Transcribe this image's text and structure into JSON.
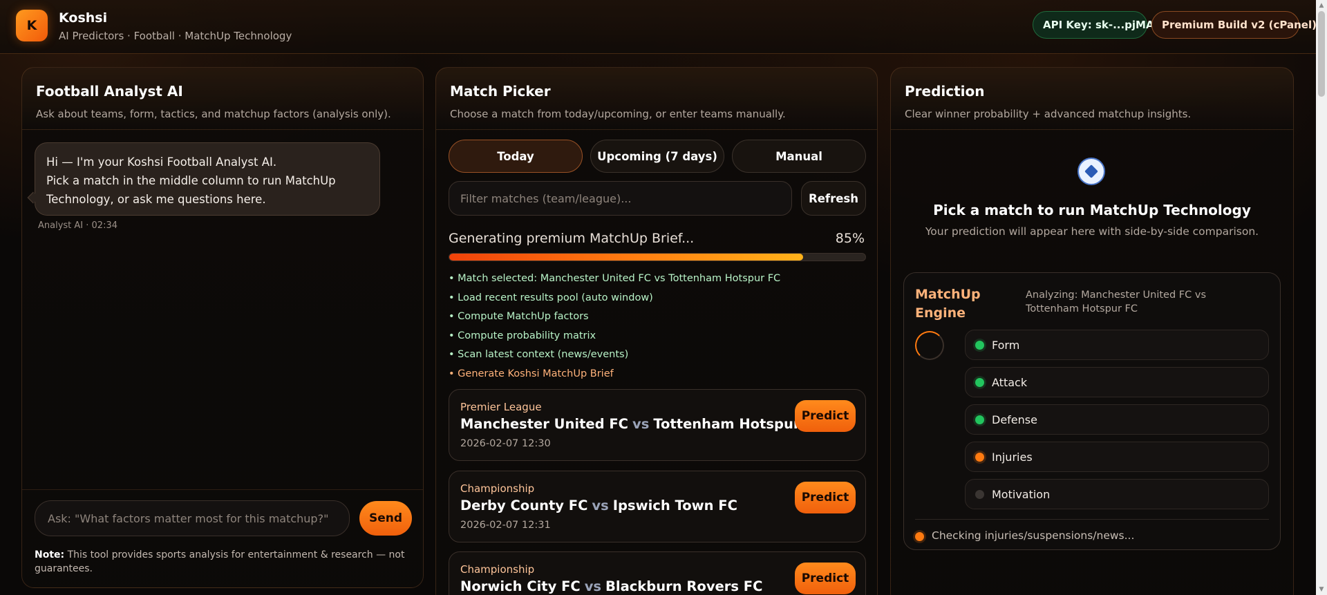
{
  "header": {
    "logo_letter": "K",
    "brand": "Koshsi",
    "subtitle": "AI Predictors · Football · MatchUp Technology",
    "api_key_label": "API Key: sk-...pjMA",
    "build_label": "Premium Build v2 (cPanel)"
  },
  "chat": {
    "title": "Football Analyst AI",
    "subtitle": "Ask about teams, form, tactics, and matchup factors (analysis only).",
    "messages": [
      {
        "line1": "Hi — I'm your Koshsi Football Analyst AI.",
        "line2": "Pick a match in the middle column to run MatchUp",
        "line3": "Technology, or ask me questions here.",
        "meta": "Analyst AI · 02:34"
      }
    ],
    "input_placeholder": "Ask: \"What factors matter most for this matchup?\"",
    "send_label": "Send",
    "note_bold": "Note:",
    "note_text": " This tool provides sports analysis for entertainment & research — not guarantees."
  },
  "picker": {
    "title": "Match Picker",
    "subtitle": "Choose a match from today/upcoming, or enter teams manually.",
    "tabs": [
      {
        "label": "Today",
        "active": true
      },
      {
        "label": "Upcoming (7 days)",
        "active": false
      },
      {
        "label": "Manual",
        "active": false
      }
    ],
    "filter_placeholder": "Filter matches (team/league)...",
    "refresh_label": "Refresh",
    "progress": {
      "label": "Generating premium MatchUp Brief...",
      "percent_text": "85%",
      "value": 0.85
    },
    "steps": [
      {
        "text": "• Match selected: Manchester United FC vs Tottenham Hotspur FC",
        "done": true
      },
      {
        "text": "• Load recent results pool (auto window)",
        "done": true
      },
      {
        "text": "• Compute MatchUp factors",
        "done": true
      },
      {
        "text": "• Compute probability matrix",
        "done": true
      },
      {
        "text": "• Scan latest context (news/events)",
        "done": true
      },
      {
        "text": "• Generate Koshsi MatchUp Brief",
        "done": false
      }
    ],
    "vs_label": "vs",
    "predict_label": "Predict",
    "matches": [
      {
        "league": "Premier League",
        "home": "Manchester United FC",
        "away": "Tottenham Hotspur FC",
        "time": "2026-02-07 12:30"
      },
      {
        "league": "Championship",
        "home": "Derby County FC",
        "away": "Ipswich Town FC",
        "time": "2026-02-07 12:31"
      },
      {
        "league": "Championship",
        "home": "Norwich City FC",
        "away": "Blackburn Rovers FC",
        "time": ""
      }
    ]
  },
  "prediction": {
    "title": "Prediction",
    "subtitle": "Clear winner probability + advanced matchup insights.",
    "icon": "soccer-ball-icon",
    "empty_title": "Pick a match to run MatchUp Technology",
    "empty_sub": "Your prediction will appear here with side-by-side comparison.",
    "engine": {
      "title": "MatchUp Engine",
      "status": "Analyzing: Manchester United FC vs Tottenham Hotspur FC",
      "factors": [
        {
          "label": "Form",
          "state": "done"
        },
        {
          "label": "Attack",
          "state": "done"
        },
        {
          "label": "Defense",
          "state": "done"
        },
        {
          "label": "Injuries",
          "state": "active"
        },
        {
          "label": "Motivation",
          "state": "pending"
        }
      ],
      "footer": "Checking injuries/suspensions/news..."
    }
  },
  "colors": {
    "accent": "#ff7a10",
    "success": "#22c55e",
    "background": "#0a0807"
  }
}
